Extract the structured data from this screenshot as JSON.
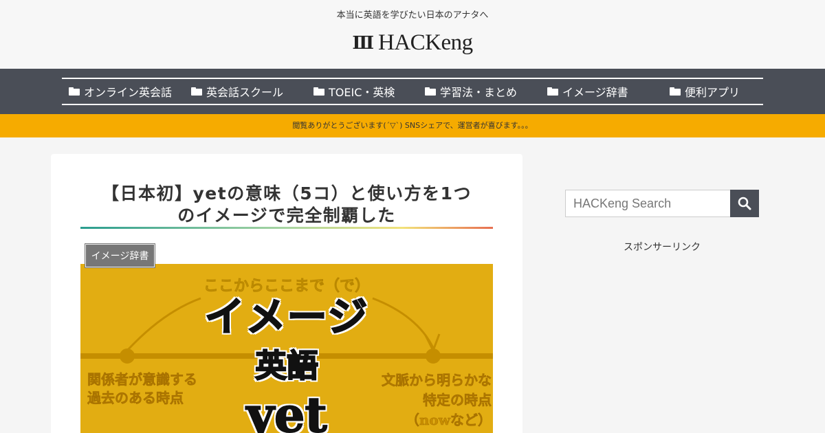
{
  "header": {
    "tagline": "本当に英語を学びたい日本のアナタへ",
    "logo_mark": "Ⅲ",
    "logo_text": "HACKeng"
  },
  "nav": {
    "items": [
      {
        "label": "オンライン英会話",
        "icon": "folder-open-icon"
      },
      {
        "label": "英会話スクール",
        "icon": "folder-open-icon"
      },
      {
        "label": "TOEIC・英検",
        "icon": "folder-open-icon"
      },
      {
        "label": "学習法・まとめ",
        "icon": "folder-open-icon"
      },
      {
        "label": "イメージ辞書",
        "icon": "folder-open-icon"
      },
      {
        "label": "便利アプリ",
        "icon": "folder-open-icon"
      }
    ]
  },
  "notice": {
    "text": "閲覧ありがとうございます(´▽`) SNSシェアで、運営者が喜びます。。。"
  },
  "post": {
    "title_line1": "【日本初】yetの意味（5コ）と使い方を1つ",
    "title_line2": "のイメージで完全制覇した",
    "category": "イメージ辞書",
    "eyecatch": {
      "top_text": "ここからここまで（で）",
      "big_line1": "イメージ",
      "big_line2": "英語",
      "big_line3": "yet",
      "left_line1": "関係者が意識する",
      "left_line2": "過去のある時点",
      "right_line1": "文脈から明らかな",
      "right_line2": "特定の時点",
      "right_line3": "（nowなど）"
    }
  },
  "sidebar": {
    "search_placeholder": "HACKeng Search",
    "search_icon": "search-icon",
    "sponsor_label": "スポンサーリンク"
  },
  "colors": {
    "nav_bg": "#4a4e57",
    "notice_bg": "#f6ab00",
    "eyecatch_bg": "#e2ad12",
    "category_bg": "#777777"
  }
}
